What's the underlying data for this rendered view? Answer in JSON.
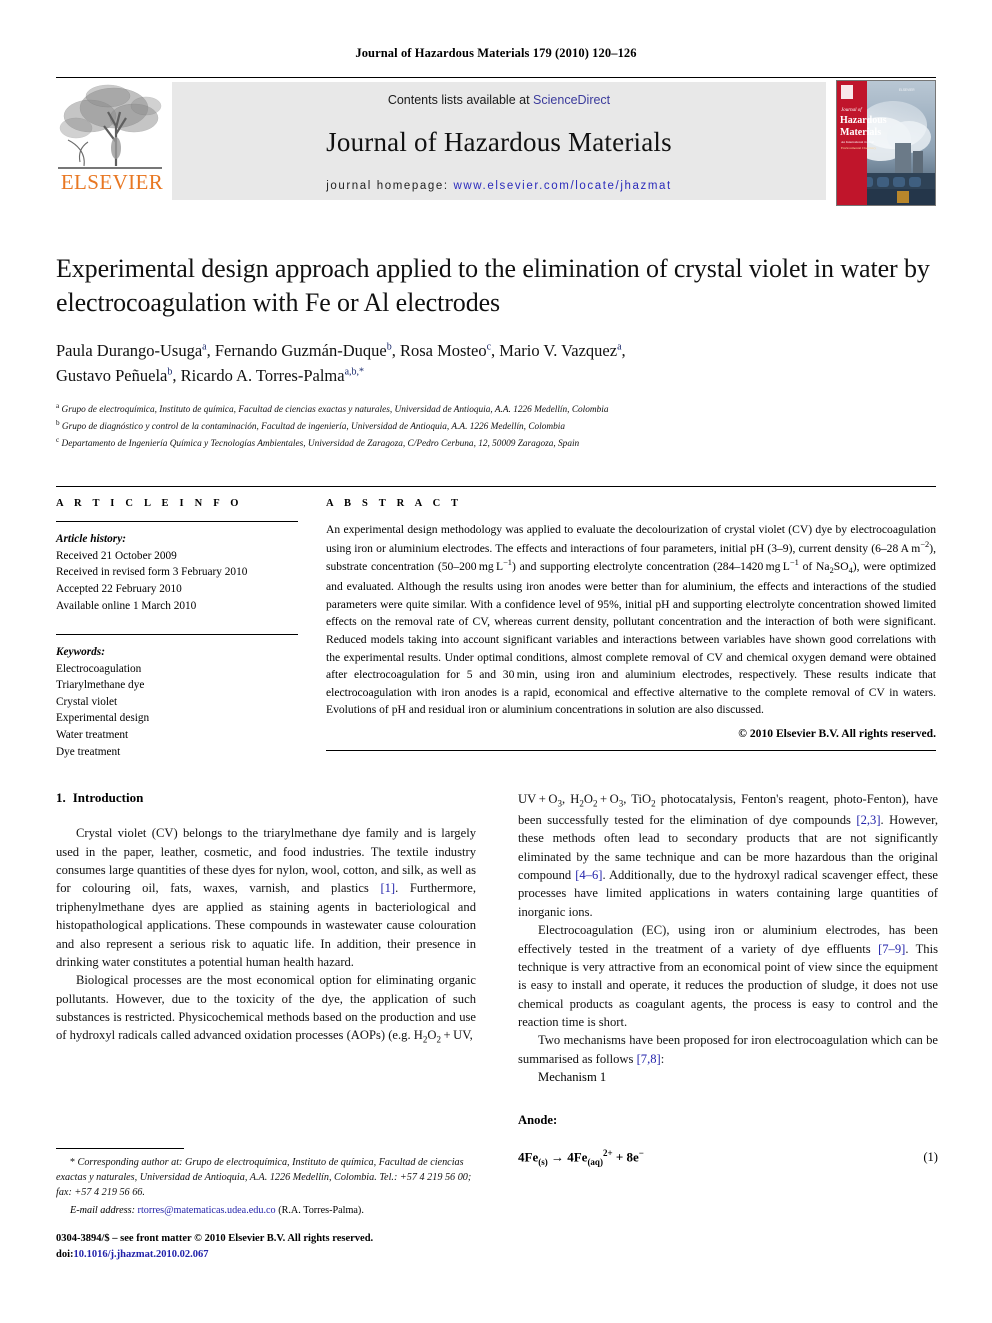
{
  "running_head": "Journal of Hazardous Materials 179 (2010) 120–126",
  "masthead": {
    "publisher_wordmark": "ELSEVIER",
    "contents_prefix": "Contents lists available at",
    "sciencedirect": "ScienceDirect",
    "journal_title": "Journal of Hazardous Materials",
    "homepage_label": "journal homepage:",
    "homepage_url": "www.elsevier.com/locate/jhazmat",
    "cover_line1": "Journal of",
    "cover_line2": "Hazardous",
    "cover_line3": "Materials",
    "colors": {
      "elsevier_orange": "#E87722",
      "link_blue": "#2b2bbb",
      "sciencedirect_blue": "#3b3b9c",
      "banner_gray": "#e8e8e8",
      "cover_red": "#c0152b"
    }
  },
  "article": {
    "title": "Experimental design approach applied to the elimination of crystal violet in water by electrocoagulation with Fe or Al electrodes",
    "authors_line1": "Paula Durango-Usuga ",
    "authors": [
      {
        "name": "Paula Durango-Usuga",
        "sup": "a"
      },
      {
        "name": "Fernando Guzmán-Duque",
        "sup": "b"
      },
      {
        "name": "Rosa Mosteo",
        "sup": "c"
      },
      {
        "name": "Mario V. Vazquez",
        "sup": "a"
      },
      {
        "name": "Gustavo Peñuela",
        "sup": "b"
      },
      {
        "name": "Ricardo A. Torres-Palma",
        "sup": "a,b,*"
      }
    ],
    "affiliations": [
      {
        "sup": "a",
        "text": "Grupo de electroquímica, Instituto de química, Facultad de ciencias exactas y naturales, Universidad de Antioquia, A.A. 1226 Medellín, Colombia"
      },
      {
        "sup": "b",
        "text": "Grupo de diagnóstico y control de la contaminación, Facultad de ingeniería, Universidad de Antioquia, A.A. 1226 Medellín, Colombia"
      },
      {
        "sup": "c",
        "text": "Departamento de Ingeniería Química y Tecnologías Ambientales, Universidad de Zaragoza, C/Pedro Cerbuna, 12, 50009 Zaragoza, Spain"
      }
    ]
  },
  "article_info": {
    "heading": "A R T I C L E  I N F O",
    "history_label": "Article history:",
    "history": [
      "Received 21 October 2009",
      "Received in revised form 3 February 2010",
      "Accepted 22 February 2010",
      "Available online 1 March 2010"
    ],
    "keywords_label": "Keywords:",
    "keywords": [
      "Electrocoagulation",
      "Triarylmethane dye",
      "Crystal violet",
      "Experimental design",
      "Water treatment",
      "Dye treatment"
    ]
  },
  "abstract": {
    "heading": "A B S T R A C T",
    "copyright": "© 2010 Elsevier B.V. All rights reserved."
  },
  "sections": {
    "intro_number": "1.",
    "intro_title": "Introduction"
  },
  "equation": {
    "anode_label": "Anode:",
    "mechanism_label": "Mechanism 1",
    "number": "(1)"
  },
  "footnote": {
    "corresponding": "Corresponding author at: Grupo de electroquímica, Instituto de química, Facultad de ciencias exactas y naturales, Universidad de Antioquia, A.A. 1226 Medellín, Colombia. Tel.: +57 4 219 56 00; fax: +57 4 219 56 66.",
    "email_label": "E-mail address:",
    "email": "rtorres@matematicas.udea.edu.co",
    "email_owner": "(R.A. Torres-Palma).",
    "issn_line": "0304-3894/$ – see front matter © 2010 Elsevier B.V. All rights reserved.",
    "doi_label": "doi:",
    "doi": "10.1016/j.jhazmat.2010.02.067"
  }
}
